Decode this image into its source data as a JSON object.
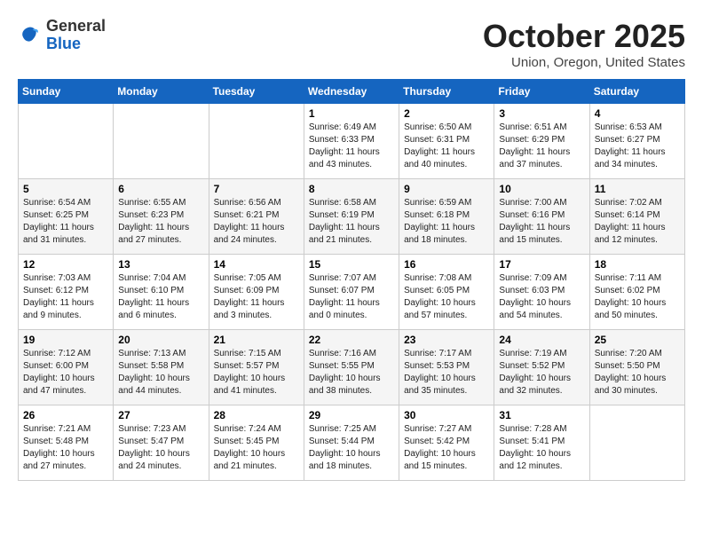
{
  "header": {
    "logo": {
      "general": "General",
      "blue": "Blue"
    },
    "title": "October 2025",
    "subtitle": "Union, Oregon, United States"
  },
  "weekdays": [
    "Sunday",
    "Monday",
    "Tuesday",
    "Wednesday",
    "Thursday",
    "Friday",
    "Saturday"
  ],
  "weeks": [
    [
      {
        "day": "",
        "info": ""
      },
      {
        "day": "",
        "info": ""
      },
      {
        "day": "",
        "info": ""
      },
      {
        "day": "1",
        "info": "Sunrise: 6:49 AM\nSunset: 6:33 PM\nDaylight: 11 hours\nand 43 minutes."
      },
      {
        "day": "2",
        "info": "Sunrise: 6:50 AM\nSunset: 6:31 PM\nDaylight: 11 hours\nand 40 minutes."
      },
      {
        "day": "3",
        "info": "Sunrise: 6:51 AM\nSunset: 6:29 PM\nDaylight: 11 hours\nand 37 minutes."
      },
      {
        "day": "4",
        "info": "Sunrise: 6:53 AM\nSunset: 6:27 PM\nDaylight: 11 hours\nand 34 minutes."
      }
    ],
    [
      {
        "day": "5",
        "info": "Sunrise: 6:54 AM\nSunset: 6:25 PM\nDaylight: 11 hours\nand 31 minutes."
      },
      {
        "day": "6",
        "info": "Sunrise: 6:55 AM\nSunset: 6:23 PM\nDaylight: 11 hours\nand 27 minutes."
      },
      {
        "day": "7",
        "info": "Sunrise: 6:56 AM\nSunset: 6:21 PM\nDaylight: 11 hours\nand 24 minutes."
      },
      {
        "day": "8",
        "info": "Sunrise: 6:58 AM\nSunset: 6:19 PM\nDaylight: 11 hours\nand 21 minutes."
      },
      {
        "day": "9",
        "info": "Sunrise: 6:59 AM\nSunset: 6:18 PM\nDaylight: 11 hours\nand 18 minutes."
      },
      {
        "day": "10",
        "info": "Sunrise: 7:00 AM\nSunset: 6:16 PM\nDaylight: 11 hours\nand 15 minutes."
      },
      {
        "day": "11",
        "info": "Sunrise: 7:02 AM\nSunset: 6:14 PM\nDaylight: 11 hours\nand 12 minutes."
      }
    ],
    [
      {
        "day": "12",
        "info": "Sunrise: 7:03 AM\nSunset: 6:12 PM\nDaylight: 11 hours\nand 9 minutes."
      },
      {
        "day": "13",
        "info": "Sunrise: 7:04 AM\nSunset: 6:10 PM\nDaylight: 11 hours\nand 6 minutes."
      },
      {
        "day": "14",
        "info": "Sunrise: 7:05 AM\nSunset: 6:09 PM\nDaylight: 11 hours\nand 3 minutes."
      },
      {
        "day": "15",
        "info": "Sunrise: 7:07 AM\nSunset: 6:07 PM\nDaylight: 11 hours\nand 0 minutes."
      },
      {
        "day": "16",
        "info": "Sunrise: 7:08 AM\nSunset: 6:05 PM\nDaylight: 10 hours\nand 57 minutes."
      },
      {
        "day": "17",
        "info": "Sunrise: 7:09 AM\nSunset: 6:03 PM\nDaylight: 10 hours\nand 54 minutes."
      },
      {
        "day": "18",
        "info": "Sunrise: 7:11 AM\nSunset: 6:02 PM\nDaylight: 10 hours\nand 50 minutes."
      }
    ],
    [
      {
        "day": "19",
        "info": "Sunrise: 7:12 AM\nSunset: 6:00 PM\nDaylight: 10 hours\nand 47 minutes."
      },
      {
        "day": "20",
        "info": "Sunrise: 7:13 AM\nSunset: 5:58 PM\nDaylight: 10 hours\nand 44 minutes."
      },
      {
        "day": "21",
        "info": "Sunrise: 7:15 AM\nSunset: 5:57 PM\nDaylight: 10 hours\nand 41 minutes."
      },
      {
        "day": "22",
        "info": "Sunrise: 7:16 AM\nSunset: 5:55 PM\nDaylight: 10 hours\nand 38 minutes."
      },
      {
        "day": "23",
        "info": "Sunrise: 7:17 AM\nSunset: 5:53 PM\nDaylight: 10 hours\nand 35 minutes."
      },
      {
        "day": "24",
        "info": "Sunrise: 7:19 AM\nSunset: 5:52 PM\nDaylight: 10 hours\nand 32 minutes."
      },
      {
        "day": "25",
        "info": "Sunrise: 7:20 AM\nSunset: 5:50 PM\nDaylight: 10 hours\nand 30 minutes."
      }
    ],
    [
      {
        "day": "26",
        "info": "Sunrise: 7:21 AM\nSunset: 5:48 PM\nDaylight: 10 hours\nand 27 minutes."
      },
      {
        "day": "27",
        "info": "Sunrise: 7:23 AM\nSunset: 5:47 PM\nDaylight: 10 hours\nand 24 minutes."
      },
      {
        "day": "28",
        "info": "Sunrise: 7:24 AM\nSunset: 5:45 PM\nDaylight: 10 hours\nand 21 minutes."
      },
      {
        "day": "29",
        "info": "Sunrise: 7:25 AM\nSunset: 5:44 PM\nDaylight: 10 hours\nand 18 minutes."
      },
      {
        "day": "30",
        "info": "Sunrise: 7:27 AM\nSunset: 5:42 PM\nDaylight: 10 hours\nand 15 minutes."
      },
      {
        "day": "31",
        "info": "Sunrise: 7:28 AM\nSunset: 5:41 PM\nDaylight: 10 hours\nand 12 minutes."
      },
      {
        "day": "",
        "info": ""
      }
    ]
  ]
}
